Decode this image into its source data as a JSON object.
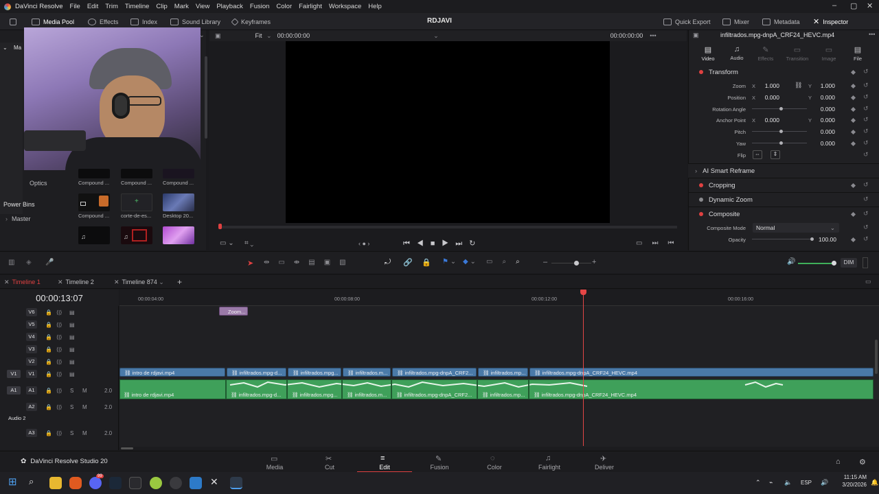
{
  "app": {
    "name": "DaVinci Resolve",
    "project_title": "RDJAVI",
    "brand": "DaVinci Resolve Studio 20"
  },
  "menu": [
    "File",
    "Edit",
    "Trim",
    "Timeline",
    "Clip",
    "Mark",
    "View",
    "Playback",
    "Fusion",
    "Color",
    "Fairlight",
    "Workspace",
    "Help"
  ],
  "toolbar": {
    "left": [
      "Media Pool",
      "Effects",
      "Index",
      "Sound Library",
      "Keyframes"
    ],
    "right": [
      "Quick Export",
      "Mixer",
      "Metadata",
      "Inspector"
    ]
  },
  "media_pool": {
    "optics": "Optics",
    "power_bins": "Power Bins",
    "master": "Master",
    "master_truncated": "Ma",
    "thumbs": [
      {
        "label": "Compound ..."
      },
      {
        "label": "Compound ..."
      },
      {
        "label": "Compound ..."
      },
      {
        "label": "Compound ..."
      },
      {
        "label": "corte-de-es..."
      },
      {
        "label": "Desktop 20..."
      },
      {
        "label": ""
      },
      {
        "label": ""
      },
      {
        "label": ""
      }
    ]
  },
  "viewer": {
    "fit": "Fit",
    "timecode_left": "00:00:00:00",
    "timecode_right": "00:00:00:00"
  },
  "inspector": {
    "clip_name": "infiltrados.mpg-dnpA_CRF24_HEVC.mp4",
    "tabs": [
      "Video",
      "Audio",
      "Effects",
      "Transition",
      "Image",
      "File"
    ],
    "transform": "Transform",
    "zoom_label": "Zoom",
    "zoom_x": "1.000",
    "zoom_y": "1.000",
    "position_label": "Position",
    "position_x": "0.000",
    "position_y": "0.000",
    "rotation_label": "Rotation Angle",
    "rotation": "0.000",
    "anchor_label": "Anchor Point",
    "anchor_x": "0.000",
    "anchor_y": "0.000",
    "pitch_label": "Pitch",
    "pitch": "0.000",
    "yaw_label": "Yaw",
    "yaw": "0.000",
    "flip_label": "Flip",
    "ai_smart_reframe": "AI Smart Reframe",
    "cropping": "Cropping",
    "dynamic_zoom": "Dynamic Zoom",
    "composite": "Composite",
    "composite_mode_label": "Composite Mode",
    "composite_mode": "Normal",
    "opacity_label": "Opacity",
    "opacity": "100.00",
    "axis_x": "X",
    "axis_y": "Y"
  },
  "edit_tools": {
    "dim": "DIM"
  },
  "timeline_tabs": [
    "Timeline 1",
    "Timeline 2",
    "Timeline 874"
  ],
  "timeline": {
    "timecode": "00:00:13:07",
    "ruler": [
      "00:00:04:00",
      "00:00:08:00",
      "00:00:12:00",
      "00:00:16:00"
    ],
    "video_tracks": [
      "V6",
      "V5",
      "V4",
      "V3",
      "V2",
      "V1"
    ],
    "v1_patch": "V1",
    "a1_patch": "A1",
    "audio_tracks": [
      "A1",
      "A2",
      "A3"
    ],
    "audio_level": "2.0",
    "audio2_name": "Audio 2",
    "s_label": "S",
    "m_label": "M",
    "zoom_clip": "Zoom...",
    "video_clips": [
      "intro de rdjavi.mp4",
      "infiltrados.mpg-d...",
      "infiltrados.mpg...",
      "infiltrados.m...",
      "infiltrados.mpg-dnpA_CRF2...",
      "infiltrados.mp...",
      "infiltrados.mpg-dnpA_CRF24_HEVC.mp4"
    ],
    "audio_clips": [
      "intro de rdjavi.mp4",
      "infiltrados.mpg-d...",
      "infiltrados.mpg...",
      "infiltrados.m...",
      "infiltrados.mpg-dnpA_CRF2...",
      "infiltrados.mp...",
      "infiltrados.mpg-dnpA_CRF24_HEVC.mp4"
    ]
  },
  "pages": [
    "Media",
    "Cut",
    "Edit",
    "Fusion",
    "Color",
    "Fairlight",
    "Deliver"
  ],
  "taskbar": {
    "lang": "ESP",
    "time": "11:15 AM",
    "date": "3/20/2026",
    "badge": "99"
  }
}
